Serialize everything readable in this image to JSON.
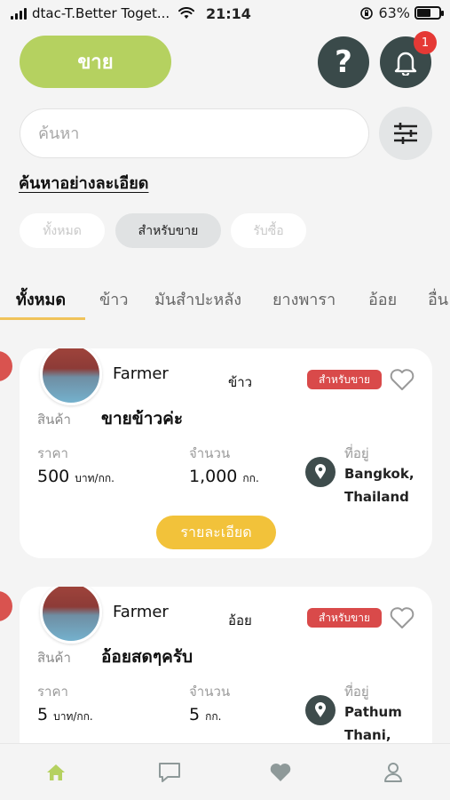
{
  "status_bar": {
    "carrier": "dtac-T.Better Toget...",
    "time": "21:14",
    "battery": "63%",
    "battery_level": 0.63,
    "icons": [
      "signal-icon",
      "wifi-icon",
      "orientation-lock-icon",
      "battery-icon"
    ]
  },
  "header": {
    "sell_label": "ขาย",
    "help_label": "?",
    "notification_count": "1"
  },
  "search": {
    "placeholder": "ค้นหา",
    "advanced_link": "ค้นหาอย่างละเอียด"
  },
  "filter_chips": [
    "ทั้งหมด",
    "สำหรับขาย",
    "รับซื้อ"
  ],
  "selected_chip": "สำหรับขาย",
  "tabs": [
    "ทั้งหมด",
    "ข้าว",
    "มันสำปะหลัง",
    "ยางพารา",
    "อ้อย",
    "อื่น"
  ],
  "active_tab": "ทั้งหมด",
  "labels": {
    "product": "สินค้า",
    "price": "ราคา",
    "quantity": "จำนวน",
    "location": "ที่อยู่",
    "details_button": "รายละเอียด"
  },
  "listings": [
    {
      "seller": "Farmer",
      "category": "ข้าว",
      "badge": "สำหรับขาย",
      "product": "ขายข้าวค่ะ",
      "price": "500",
      "price_unit": "บาท/กก.",
      "quantity": "1,000",
      "quantity_unit": "กก.",
      "location_line1": "Bangkok,",
      "location_line2": "Thailand"
    },
    {
      "seller": "Farmer",
      "category": "อ้อย",
      "badge": "สำหรับขาย",
      "product": "อ้อยสดๆครับ",
      "price": "5",
      "price_unit": "บาท/กก.",
      "quantity": "5",
      "quantity_unit": "กก.",
      "location_line1": "Pathum",
      "location_line2": "Thani,"
    }
  ],
  "bottom_nav": [
    "home-icon",
    "chat-icon",
    "favorites-heart-icon",
    "profile-icon"
  ],
  "colors": {
    "sell_button": "#b5d160",
    "dark_button": "#3a4a4a",
    "badge_red": "#d94a4a",
    "tab_underline": "#f0c35a",
    "detail_button": "#f2c23a",
    "nav_active": "#b5d160",
    "nav_inactive": "#8e9999"
  }
}
